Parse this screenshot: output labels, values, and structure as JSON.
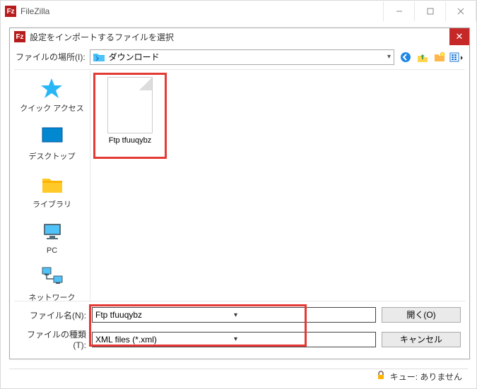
{
  "main_window": {
    "title": "FileZilla"
  },
  "dialog": {
    "title": "設定をインポートするファイルを選択",
    "location_label": "ファイルの場所(I):",
    "location_value": "ダウンロード",
    "places": [
      {
        "id": "quick-access",
        "label": "クイック アクセス"
      },
      {
        "id": "desktop",
        "label": "デスクトップ"
      },
      {
        "id": "libraries",
        "label": "ライブラリ"
      },
      {
        "id": "pc",
        "label": "PC"
      },
      {
        "id": "network",
        "label": "ネットワーク"
      }
    ],
    "file_item": {
      "label": "Ftp tfuuqybz"
    },
    "filename_label": "ファイル名(N):",
    "filename_value": "Ftp tfuuqybz",
    "filetype_label": "ファイルの種類(T):",
    "filetype_value": "XML files (*.xml)",
    "open_btn": "開く(O)",
    "cancel_btn": "キャンセル"
  },
  "status": {
    "queue_label": "キュー: ありません"
  }
}
